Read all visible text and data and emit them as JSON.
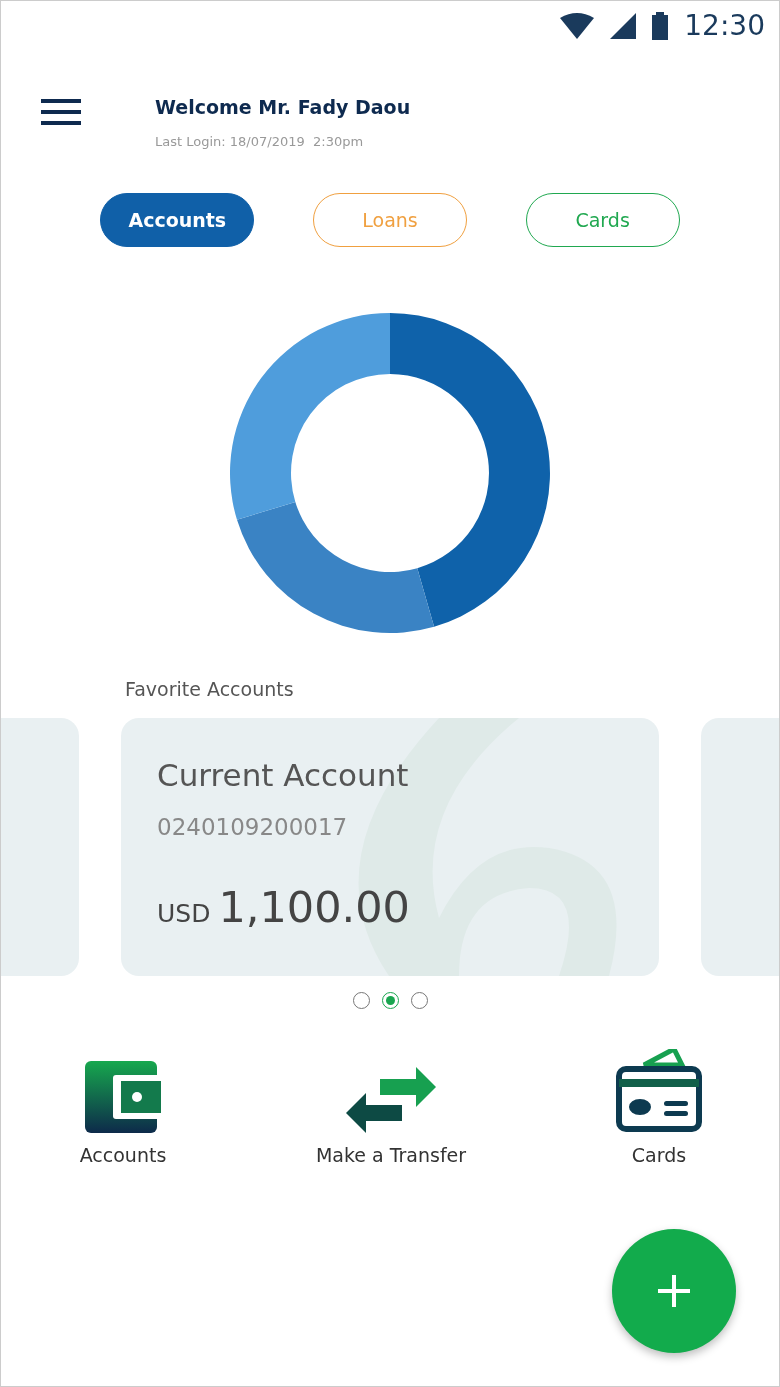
{
  "status_bar": {
    "time": "12:30"
  },
  "header": {
    "greeting": "Welcome Mr. Fady Daou",
    "last_login": "Last Login: 18/07/2019  2:30pm"
  },
  "tabs": [
    {
      "label": "Accounts",
      "selected": true,
      "color": "#1060a8"
    },
    {
      "label": "Loans",
      "selected": false,
      "color": "#f0a040"
    },
    {
      "label": "Cards",
      "selected": false,
      "color": "#20a850"
    }
  ],
  "favorites": {
    "title": "Favorite Accounts",
    "card": {
      "name": "Current Account",
      "number": "0240109200017",
      "currency": "USD",
      "amount": "1,100.00"
    }
  },
  "pager": [
    {
      "selected": false
    },
    {
      "selected": true
    },
    {
      "selected": false
    }
  ],
  "shortcuts": [
    {
      "kind": "wallet",
      "label": "Accounts"
    },
    {
      "kind": "transfer",
      "label": "Make a Transfer"
    },
    {
      "kind": "card",
      "label": "Cards"
    }
  ]
}
